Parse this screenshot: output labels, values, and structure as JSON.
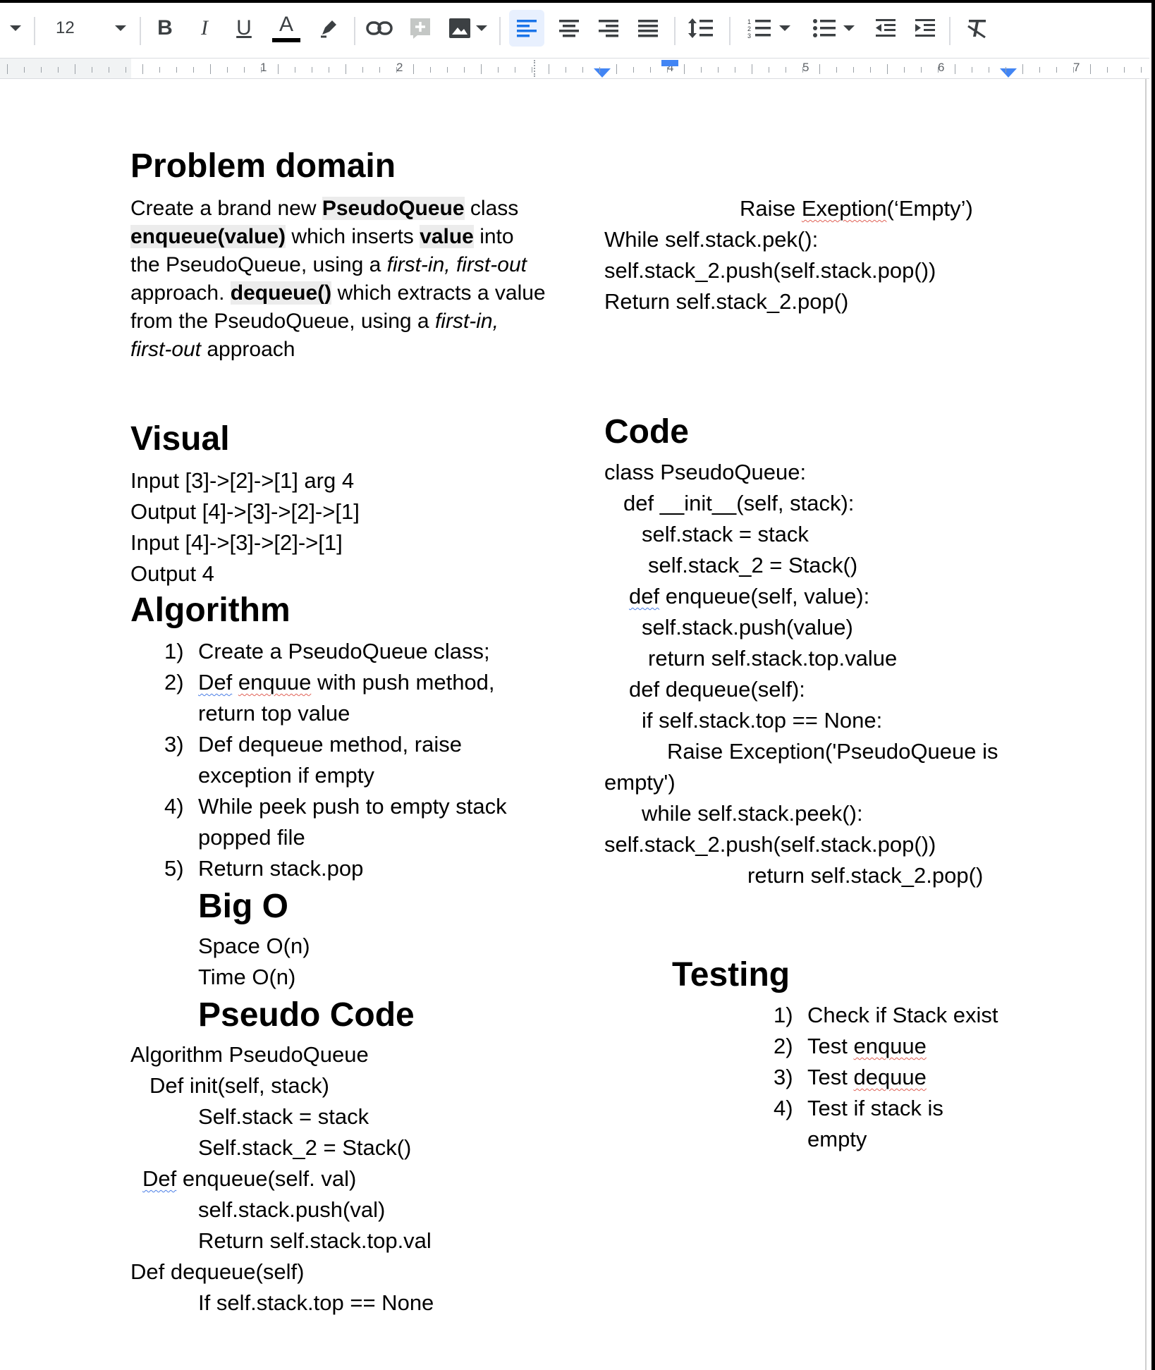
{
  "toolbar": {
    "font_size": "12",
    "buttons": [
      "bold",
      "italic",
      "underline",
      "text-color",
      "highlight",
      "link",
      "comment",
      "image",
      "align-left",
      "align-center",
      "align-right",
      "justify",
      "line-spacing",
      "numbered-list",
      "bulleted-list",
      "decrease-indent",
      "increase-indent",
      "clear-formatting"
    ],
    "bold_glyph": "B",
    "italic_glyph": "I",
    "underline_glyph": "U",
    "textcolor_glyph": "A"
  },
  "ruler": {
    "numbers": [
      "1",
      "2",
      "3",
      "4",
      "5",
      "6",
      "7"
    ]
  },
  "left": {
    "problem_heading": "Problem domain",
    "problem": [
      {
        "a": "Create a brand new ",
        "b": "PseudoQueue",
        "c": " class"
      },
      {
        "a": "",
        "b": "enqueue(value)",
        "c": " which inserts ",
        "d": "value",
        "e": " into"
      },
      {
        "a": "the PseudoQueue, using a ",
        "i": "first-in, first-out"
      },
      {
        "a": "approach. ",
        "b": "dequeue()",
        "c": " which extracts a value"
      },
      {
        "a": "from the PseudoQueue, using a ",
        "i": "first-in,"
      },
      {
        "a": "",
        "i": "first-out",
        "c": " approach"
      }
    ],
    "visual_heading": "Visual",
    "visual_lines": [
      "Input [3]->[2]->[1] arg 4",
      "Output [4]->[3]->[2]->[1]",
      "Input [4]->[3]->[2]->[1]",
      "Output 4"
    ],
    "algorithm_heading": "Algorithm",
    "algorithm_numbers": [
      "1)",
      "2)",
      "3)",
      "4)",
      "5)"
    ],
    "algorithm_1": "Create a PseudoQueue class;",
    "algorithm_2a": "Def",
    "algorithm_2b": "enquue",
    "algorithm_2c": " with push method,",
    "algorithm_2d": "return top value",
    "algorithm_3a": "Def dequeue method, raise",
    "algorithm_3b": "exception if empty",
    "algorithm_4a": "While peek push to empty stack",
    "algorithm_4b": "popped file",
    "algorithm_5": "Return stack.pop",
    "bigo_heading": "Big O",
    "space": "Space O(n)",
    "time": "Time O(n)",
    "pseudo_heading": "Pseudo Code",
    "pseudo_1": "Algorithm PseudoQueue",
    "pseudo_2": "Def init(self, stack)",
    "pseudo_3": "Self.stack = stack",
    "pseudo_4": "Self.stack_2 = Stack()",
    "pseudo_5a": "Def",
    "pseudo_5b": " enqueue(self. val)",
    "pseudo_6": "self.stack.push(val)",
    "pseudo_7": "Return self.stack.top.val",
    "pseudo_8": "Def dequeue(self)",
    "pseudo_9": "If self.stack.top == None"
  },
  "right": {
    "cont_1a": "Raise ",
    "cont_1b": "Exeption",
    "cont_1c": "(‘Empty’)",
    "cont_2": "While self.stack.pek():",
    "cont_3": "self.stack_2.push(self.stack.pop())",
    "cont_4": "Return self.stack_2.pop()",
    "code_heading": "Code",
    "code_1": "class PseudoQueue:",
    "code_2": "def __init__(self, stack):",
    "code_3": "self.stack = stack",
    "code_4": "self.stack_2 = Stack()",
    "code_5a": "def",
    "code_5b": " enqueue(self, value):",
    "code_6": "self.stack.push(value)",
    "code_7": "return self.stack.top.value",
    "code_8": "def dequeue(self):",
    "code_9": "if self.stack.top == None:",
    "code_10": "Raise Exception('PseudoQueue is",
    "code_11": "empty')",
    "code_12": "while self.stack.peek():",
    "code_13": "self.stack_2.push(self.stack.pop())",
    "code_14": "return self.stack_2.pop()",
    "testing_heading": "Testing",
    "testing_numbers": [
      "1)",
      "2)",
      "3)",
      "4)"
    ],
    "test_1": "Check if Stack exist",
    "test_2a": "Test ",
    "test_2b": "enquue",
    "test_3a": "Test ",
    "test_3b": "dequue",
    "test_4a": "Test if stack is",
    "test_4b": "empty"
  }
}
